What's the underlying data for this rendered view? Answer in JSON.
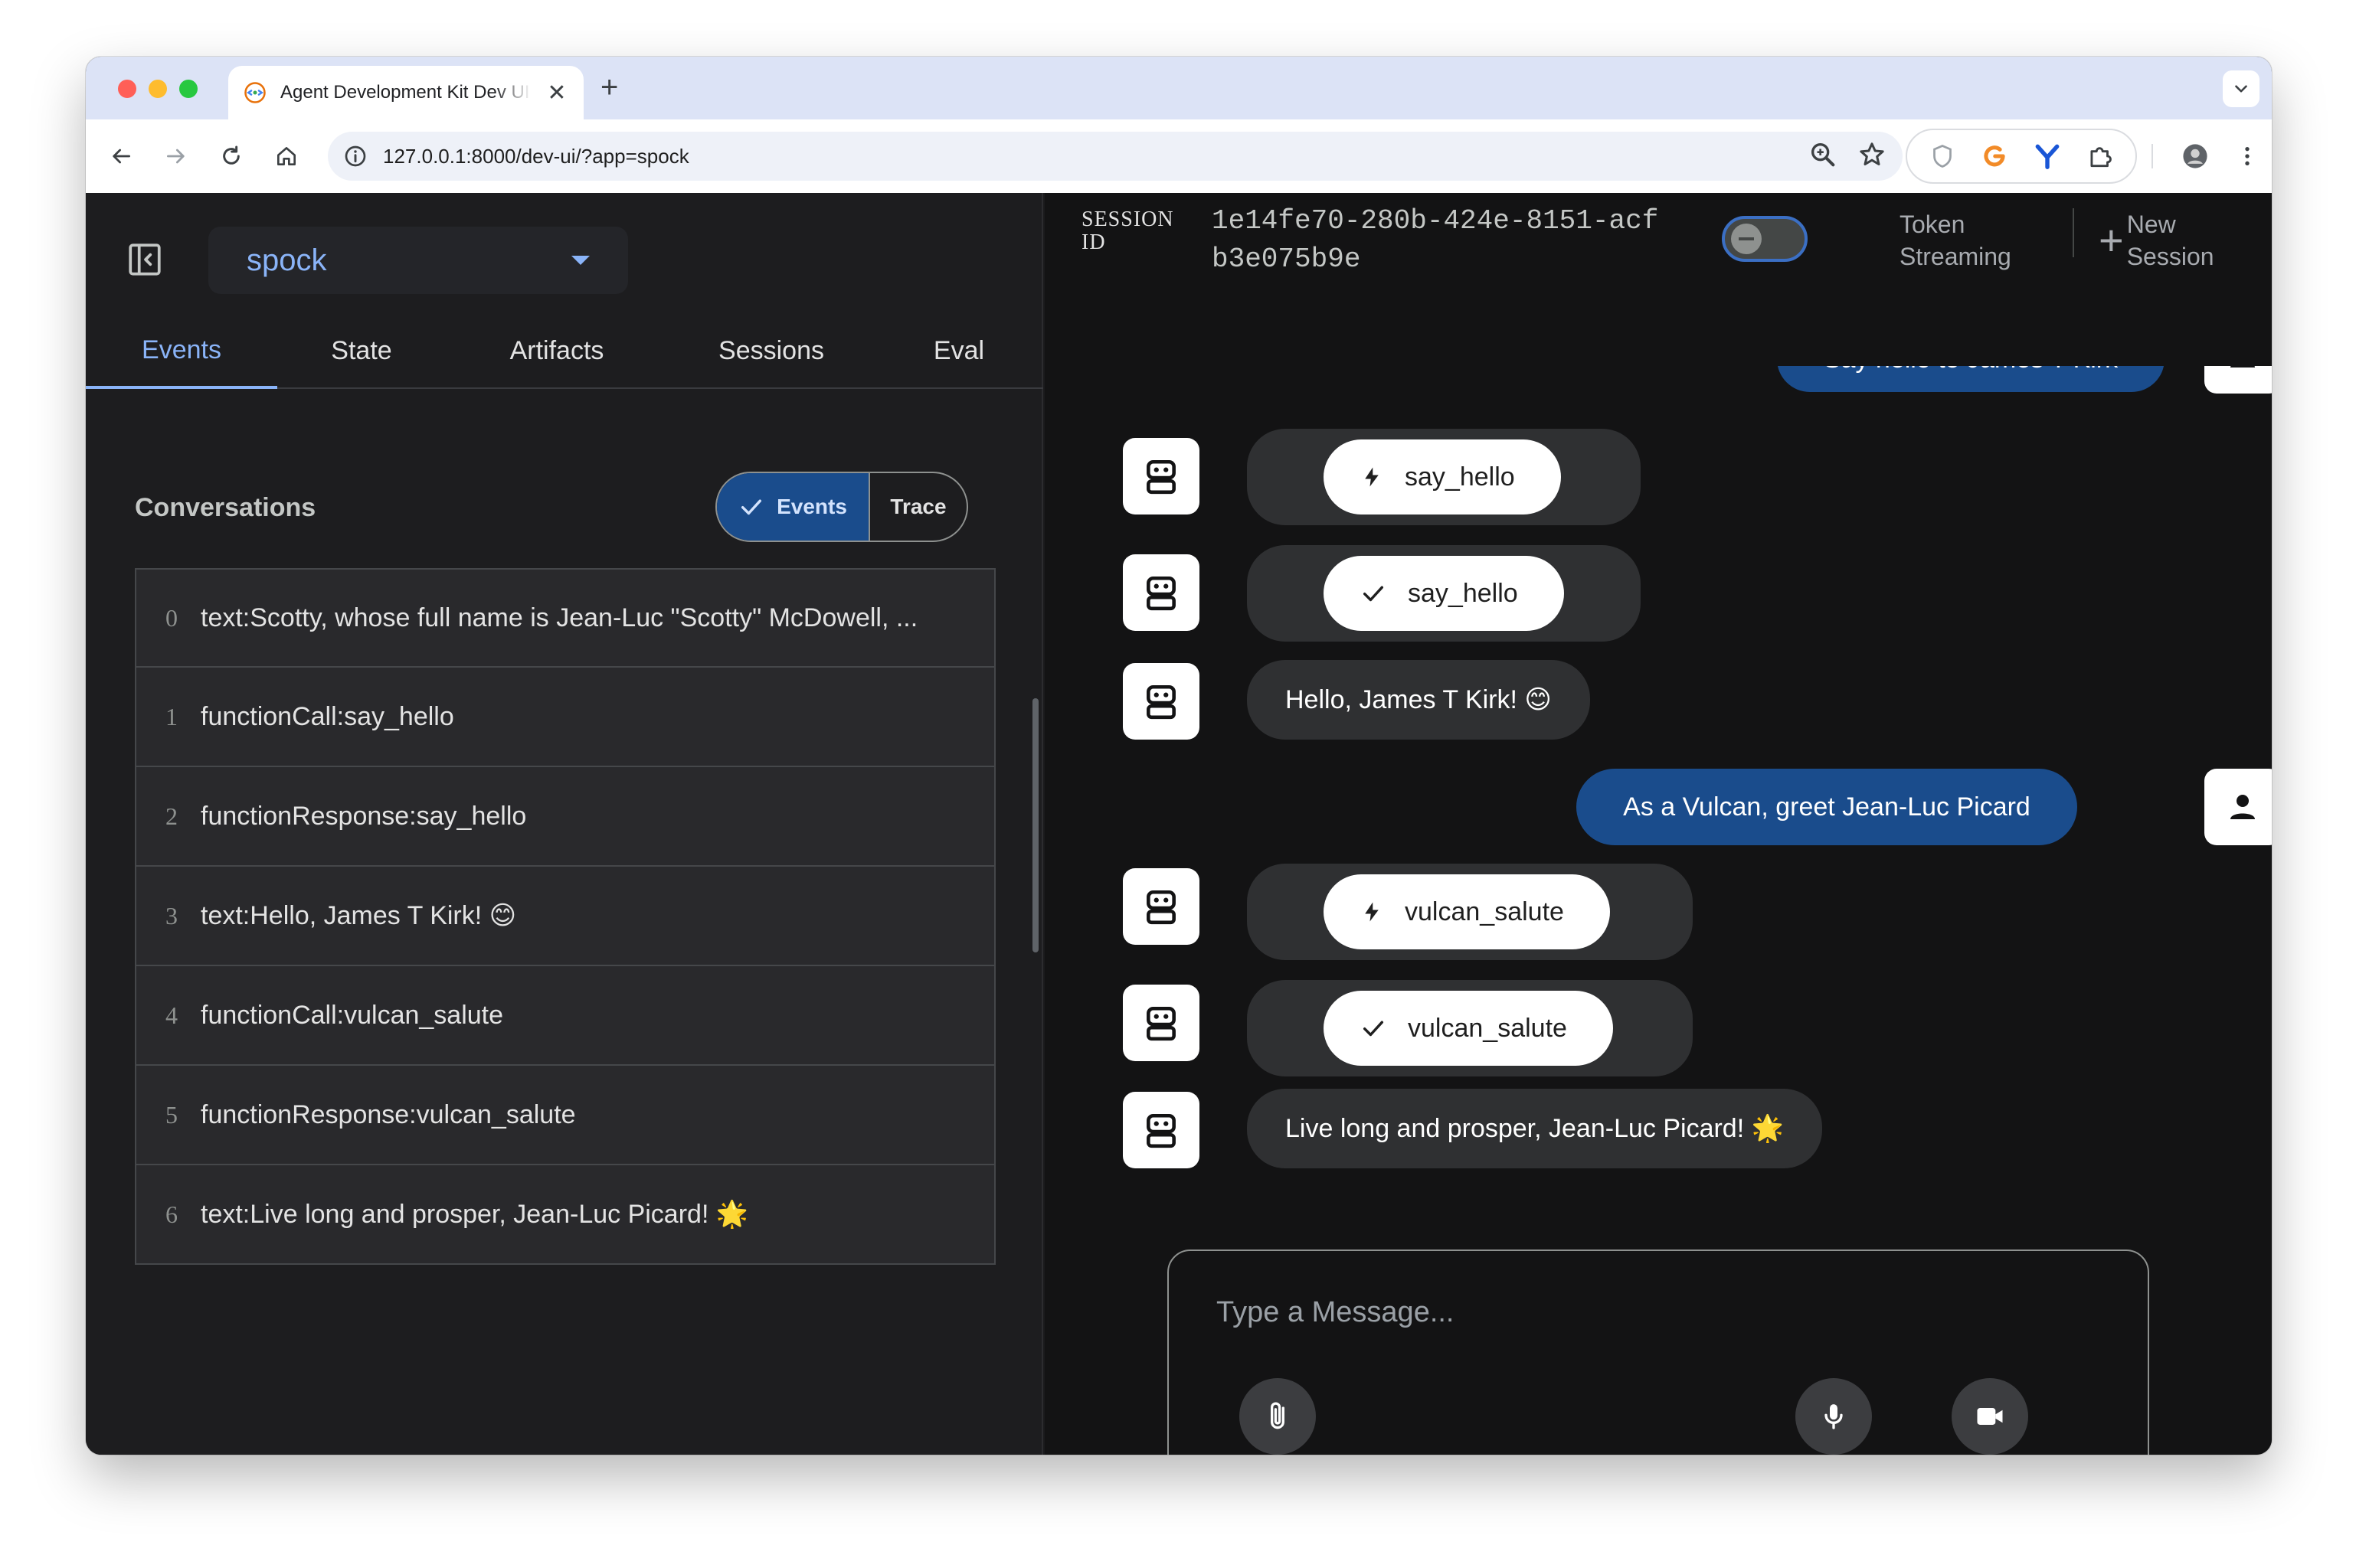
{
  "browser": {
    "tab_title": "Agent Development Kit Dev UI",
    "tab_close": "✕",
    "new_tab": "+",
    "url": "127.0.0.1:8000/dev-ui/?app=spock"
  },
  "sidebar": {
    "app_name": "spock",
    "tabs": [
      {
        "label": "Events",
        "active": true
      },
      {
        "label": "State",
        "active": false
      },
      {
        "label": "Artifacts",
        "active": false
      },
      {
        "label": "Sessions",
        "active": false
      },
      {
        "label": "Eval",
        "active": false
      }
    ],
    "conversations_title": "Conversations",
    "view_toggle": {
      "events_label": "Events",
      "trace_label": "Trace",
      "selected": "Events"
    },
    "events": [
      {
        "index": "0",
        "text": "text:Scotty, whose full name is Jean-Luc \"Scotty\" McDowell, ..."
      },
      {
        "index": "1",
        "text": "functionCall:say_hello"
      },
      {
        "index": "2",
        "text": "functionResponse:say_hello"
      },
      {
        "index": "3",
        "text": "text:Hello, James T Kirk! 😊"
      },
      {
        "index": "4",
        "text": "functionCall:vulcan_salute"
      },
      {
        "index": "5",
        "text": "functionResponse:vulcan_salute"
      },
      {
        "index": "6",
        "text": "text:Live long and prosper, Jean-Luc Picard! 🌟"
      }
    ]
  },
  "chat": {
    "session_label_line1": "SESSION",
    "session_label_line2": "ID",
    "session_id": "1e14fe70-280b-424e-8151-acfb3e075b9e",
    "token_streaming_line1": "Token",
    "token_streaming_line2": "Streaming",
    "token_streaming_on": false,
    "new_session_plus": "+",
    "new_session_line1": "New",
    "new_session_line2": "Session",
    "messages": [
      {
        "role": "user",
        "kind": "text",
        "text": "Say hello to James T Kirk"
      },
      {
        "role": "bot",
        "kind": "function_call",
        "text": "say_hello",
        "icon": "bolt-icon"
      },
      {
        "role": "bot",
        "kind": "function_response",
        "text": "say_hello",
        "icon": "check-icon"
      },
      {
        "role": "bot",
        "kind": "text",
        "text": "Hello, James T Kirk! 😊"
      },
      {
        "role": "user",
        "kind": "text",
        "text": "As a Vulcan, greet Jean-Luc Picard"
      },
      {
        "role": "bot",
        "kind": "function_call",
        "text": "vulcan_salute",
        "icon": "bolt-icon"
      },
      {
        "role": "bot",
        "kind": "function_response",
        "text": "vulcan_salute",
        "icon": "check-icon"
      },
      {
        "role": "bot",
        "kind": "text",
        "text": "Live long and prosper, Jean-Luc Picard! 🌟"
      }
    ],
    "input": {
      "placeholder": "Type a Message...",
      "value": ""
    }
  },
  "colors": {
    "accent": "#8ab4f8",
    "user_bubble": "#1a4c8c",
    "bot_bubble": "#2f3032",
    "sidebar_bg": "#1d1d1f",
    "chat_bg": "#131314"
  }
}
